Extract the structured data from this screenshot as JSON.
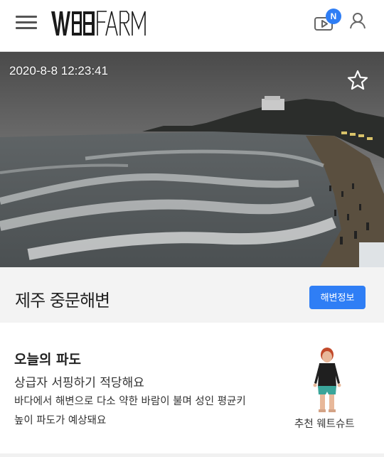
{
  "header": {
    "logo_text": "WSBFARM",
    "badge": "N"
  },
  "camera": {
    "timestamp": "2020-8-8 12:23:41"
  },
  "beach": {
    "name": "제주 중문해변",
    "info_button": "해변정보"
  },
  "wave": {
    "title": "오늘의 파도",
    "level": "상급자 서핑하기 적당해요",
    "description_line1": "바다에서 해변으로 다소 약한 바람이 불며 성인 평균키",
    "description_line2": "높이 파도가 예상돼요",
    "wetsuit_label": "추천 웨트슈트"
  },
  "colors": {
    "accent": "#2f7ef5",
    "header_bg": "#ffffff",
    "card_bg": "#ffffff",
    "bar_bg": "#f3f3f3"
  },
  "icons": [
    "menu-icon",
    "tv-icon",
    "user-icon",
    "star-icon"
  ]
}
